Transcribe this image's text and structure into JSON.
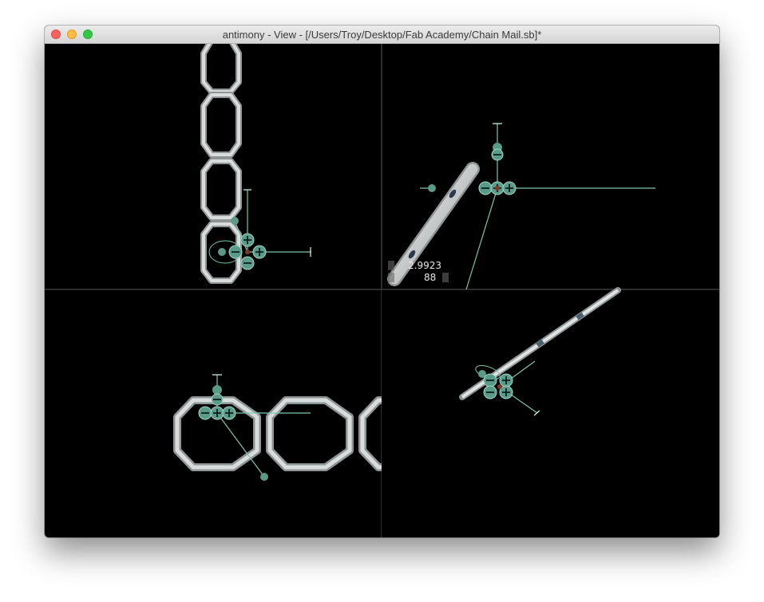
{
  "window": {
    "title": "antimony - View - [/Users/Troy/Desktop/Fab Academy/Chain Mail.sb]*"
  },
  "viewports": [
    {
      "name": "top-left-view"
    },
    {
      "name": "top-right-view"
    },
    {
      "name": "bottom-left-view"
    },
    {
      "name": "bottom-right-view"
    }
  ],
  "readout": {
    "line1": "2.9923",
    "line2": "88"
  },
  "colors": {
    "background": "#000000",
    "handle": "#5a9a88",
    "handle_line": "#7fc4b0",
    "geometry": "#c8cccc",
    "divider": "#3a3a3a"
  },
  "icons": [
    "close-icon",
    "minimize-icon",
    "maximize-icon",
    "plus-icon",
    "minus-icon"
  ]
}
